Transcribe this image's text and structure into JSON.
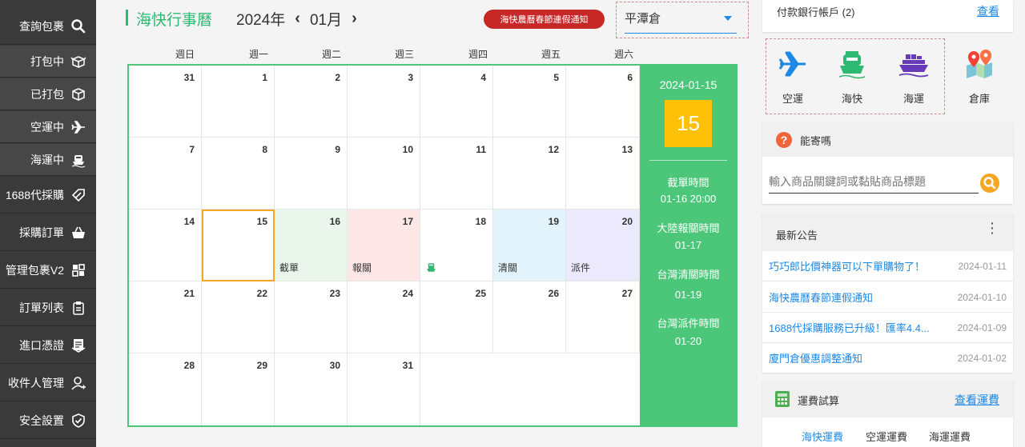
{
  "sidebar": {
    "items": [
      {
        "label": "查詢包裹",
        "icon": "search-icon"
      },
      {
        "label": "打包中",
        "icon": "box-open-icon"
      },
      {
        "label": "已打包",
        "icon": "box-icon"
      },
      {
        "label": "空運中",
        "icon": "plane-icon"
      },
      {
        "label": "海運中",
        "icon": "ship-icon"
      },
      {
        "label": "1688代採購",
        "icon": "tag-icon"
      },
      {
        "label": "採購訂單",
        "icon": "basket-icon"
      },
      {
        "label": "管理包裹V2",
        "icon": "grid-icon"
      },
      {
        "label": "訂單列表",
        "icon": "clipboard-icon"
      },
      {
        "label": "進口憑證",
        "icon": "document-icon"
      },
      {
        "label": "收件人管理",
        "icon": "user-icon"
      },
      {
        "label": "安全設置",
        "icon": "shield-check-icon"
      }
    ]
  },
  "calendar": {
    "title": "海快行事曆",
    "year": "2024年",
    "month": "01月",
    "prev": "‹",
    "next": "›",
    "notice_button": "海快農曆春節連假通知",
    "warehouse": "平潭倉",
    "weekdays": [
      "週日",
      "週一",
      "週二",
      "週三",
      "週四",
      "週五",
      "週六"
    ],
    "weeks": [
      [
        "31",
        "1",
        "2",
        "3",
        "4",
        "5",
        "6"
      ],
      [
        "7",
        "8",
        "9",
        "10",
        "11",
        "12",
        "13"
      ],
      [
        "14",
        "15",
        "16",
        "17",
        "18",
        "19",
        "20"
      ],
      [
        "21",
        "22",
        "23",
        "24",
        "25",
        "26",
        "27"
      ],
      [
        "28",
        "29",
        "30",
        "31",
        "",
        "",
        ""
      ]
    ],
    "events": {
      "cutoff": "截單",
      "declare": "報關",
      "clear": "清關",
      "deliver": "派件"
    },
    "colors": {
      "cutoff": "#eaf6ec",
      "declare": "#fde6e6",
      "clear": "#e3f3fb",
      "deliver": "#ebe9fb",
      "accent": "#4cc77a",
      "today_border": "#f5a623"
    },
    "panel": {
      "date": "2024-01-15",
      "day": "15",
      "cutoff_label": "截單時間",
      "cutoff_value": "01-16 20:00",
      "declare_label": "大陸報關時間",
      "declare_value": "01-17",
      "clear_label": "台灣清關時間",
      "clear_value": "01-19",
      "deliver_label": "台灣派件時間",
      "deliver_value": "01-20"
    }
  },
  "right": {
    "bank": {
      "label": "付款銀行帳戶 (2)",
      "link": "查看"
    },
    "services": [
      {
        "label": "空運",
        "icon": "plane-icon"
      },
      {
        "label": "海快",
        "icon": "fast-ship-icon"
      },
      {
        "label": "海運",
        "icon": "cargo-ship-icon"
      },
      {
        "label": "倉庫",
        "icon": "map-pin-icon"
      }
    ],
    "can_ship": {
      "title": "能寄嗎",
      "placeholder": "輸入商品關鍵詞或黏貼商品標題"
    },
    "announcements": {
      "title": "最新公告",
      "items": [
        {
          "text": "巧巧郎比價神器可以下單購物了！",
          "date": "2024-01-11"
        },
        {
          "text": "海快農曆春節連假通知",
          "date": "2024-01-10"
        },
        {
          "text": "1688代採購服務已升級！匯率4.4...",
          "date": "2024-01-09"
        },
        {
          "text": "廈門倉優惠調整通知",
          "date": "2024-01-02"
        }
      ]
    },
    "freight": {
      "title": "運費試算",
      "link": "查看運費",
      "tabs": [
        "海快運費",
        "空運運費",
        "海運運費"
      ]
    }
  }
}
